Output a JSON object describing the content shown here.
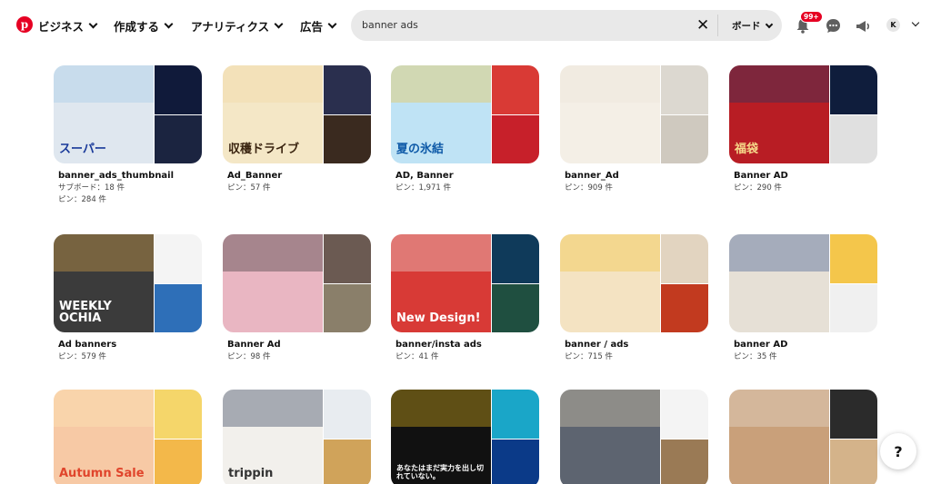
{
  "header": {
    "nav": [
      {
        "label": "ビジネス"
      },
      {
        "label": "作成する"
      },
      {
        "label": "アナリティクス"
      },
      {
        "label": "広告"
      }
    ],
    "search": {
      "value": "banner ads",
      "board_label": "ボード"
    },
    "notification_badge": "99+",
    "avatar_initial": "K",
    "colors": {
      "brand": "#e60023",
      "search_bg": "#e9e9e9"
    }
  },
  "boards": [
    {
      "title": "banner_ads_thumbnail",
      "meta": [
        "サブボード：18 件",
        "ピン：284 件"
      ],
      "thumb_text": "スーパー",
      "colors": [
        "#dfe7ef",
        "#101a3a",
        "#9fc8e8",
        "#1b2440"
      ]
    },
    {
      "title": "Ad_Banner",
      "meta": [
        "ピン：57 件"
      ],
      "thumb_text": "収穫ドライブ",
      "colors": [
        "#f4e7c6",
        "#2a2f4e",
        "#f0d7a0",
        "#3a2a1f"
      ]
    },
    {
      "title": "AD, Banner",
      "meta": [
        "ピン：1,971 件"
      ],
      "thumb_text": "夏の氷結",
      "colors": [
        "#bfe3f5",
        "#d93a35",
        "#f3c23a",
        "#c7202a"
      ]
    },
    {
      "title": "banner_Ad",
      "meta": [
        "ピン：909 件"
      ],
      "thumb_text": "",
      "colors": [
        "#f4efe6",
        "#dcd8d0",
        "#ebe4d6",
        "#cfc9bf"
      ]
    },
    {
      "title": "Banner AD",
      "meta": [
        "ピン：290 件"
      ],
      "thumb_text": "福袋",
      "colors": [
        "#b81d24",
        "#0f1d3c",
        "#123a6b",
        "#e0e0e0"
      ]
    },
    {
      "title": "Ad banners",
      "meta": [
        "ピン：579 件"
      ],
      "thumb_text": "WEEKLY OCHIA",
      "colors": [
        "#3b3b3b",
        "#f4f4f4",
        "#e8b04a",
        "#2e6fb8"
      ]
    },
    {
      "title": "Banner Ad",
      "meta": [
        "ピン：98 件"
      ],
      "thumb_text": "",
      "colors": [
        "#e9b6c2",
        "#6b5a52",
        "#2b2b2b",
        "#8a7f6a"
      ]
    },
    {
      "title": "banner/insta ads",
      "meta": [
        "ピン：41 件"
      ],
      "thumb_text": "New Design!",
      "colors": [
        "#d83a36",
        "#0f3a5a",
        "#f0eee8",
        "#1f4f40"
      ]
    },
    {
      "title": "banner / ads",
      "meta": [
        "ピン：715 件"
      ],
      "thumb_text": "",
      "colors": [
        "#f4e3c2",
        "#e2d4c0",
        "#f0c030",
        "#c23a1f"
      ]
    },
    {
      "title": "banner AD",
      "meta": [
        "ピン：35 件"
      ],
      "thumb_text": "",
      "colors": [
        "#e6e0d6",
        "#f4c64b",
        "#2a4a8a",
        "#f0f0f0"
      ]
    },
    {
      "title": "",
      "meta": [],
      "thumb_text": "Autumn Sale",
      "colors": [
        "#f7c9a5",
        "#f5d66a",
        "#fbe9b8",
        "#f3b84a"
      ]
    },
    {
      "title": "",
      "meta": [],
      "thumb_text": "trippin",
      "colors": [
        "#f2f0ec",
        "#e8ecf0",
        "#1d2b4a",
        "#d0a35a"
      ]
    },
    {
      "title": "",
      "meta": [],
      "thumb_text": "あなたはまだ実力を出し切れていない。",
      "colors": [
        "#111111",
        "#1aa6c8",
        "#f2c21e",
        "#0b3a88"
      ]
    },
    {
      "title": "",
      "meta": [],
      "thumb_text": "",
      "colors": [
        "#5d6470",
        "#f4f4f4",
        "#e7d7b5",
        "#9a7a55"
      ]
    },
    {
      "title": "",
      "meta": [],
      "thumb_text": "",
      "colors": [
        "#c9a07a",
        "#2b2b2b",
        "#e9e3da",
        "#d4b38a"
      ]
    }
  ],
  "help_label": "?"
}
